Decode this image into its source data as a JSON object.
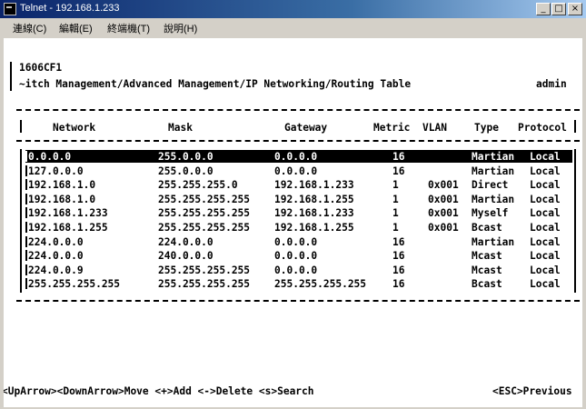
{
  "window": {
    "title": "Telnet - 192.168.1.233",
    "buttons": [
      "_",
      "□",
      "×"
    ]
  },
  "menu": {
    "items": [
      "連線(C)",
      "編輯(E)",
      "終端機(T)",
      "說明(H)"
    ]
  },
  "header": {
    "device": "1606CF1",
    "path": "~itch Management/Advanced Management/IP Networking/Routing Table",
    "user": "admin"
  },
  "table": {
    "columns": [
      "Network",
      "Mask",
      "Gateway",
      "Metric",
      "VLAN",
      "Type",
      "Protocol"
    ],
    "rows": [
      {
        "network": "0.0.0.0",
        "mask": "255.0.0.0",
        "gateway": "0.0.0.0",
        "metric": "16",
        "vlan": "",
        "type": "Martian",
        "protocol": "Local",
        "selected": true
      },
      {
        "network": "127.0.0.0",
        "mask": "255.0.0.0",
        "gateway": "0.0.0.0",
        "metric": "16",
        "vlan": "",
        "type": "Martian",
        "protocol": "Local"
      },
      {
        "network": "192.168.1.0",
        "mask": "255.255.255.0",
        "gateway": "192.168.1.233",
        "metric": "1",
        "vlan": "0x001",
        "type": "Direct",
        "protocol": "Local"
      },
      {
        "network": "192.168.1.0",
        "mask": "255.255.255.255",
        "gateway": "192.168.1.255",
        "metric": "1",
        "vlan": "0x001",
        "type": "Martian",
        "protocol": "Local"
      },
      {
        "network": "192.168.1.233",
        "mask": "255.255.255.255",
        "gateway": "192.168.1.233",
        "metric": "1",
        "vlan": "0x001",
        "type": "Myself",
        "protocol": "Local"
      },
      {
        "network": "192.168.1.255",
        "mask": "255.255.255.255",
        "gateway": "192.168.1.255",
        "metric": "1",
        "vlan": "0x001",
        "type": "Bcast",
        "protocol": "Local"
      },
      {
        "network": "224.0.0.0",
        "mask": "224.0.0.0",
        "gateway": "0.0.0.0",
        "metric": "16",
        "vlan": "",
        "type": "Martian",
        "protocol": "Local"
      },
      {
        "network": "224.0.0.0",
        "mask": "240.0.0.0",
        "gateway": "0.0.0.0",
        "metric": "16",
        "vlan": "",
        "type": "Mcast",
        "protocol": "Local"
      },
      {
        "network": "224.0.0.9",
        "mask": "255.255.255.255",
        "gateway": "0.0.0.0",
        "metric": "16",
        "vlan": "",
        "type": "Mcast",
        "protocol": "Local"
      },
      {
        "network": "255.255.255.255",
        "mask": "255.255.255.255",
        "gateway": "255.255.255.255",
        "metric": "16",
        "vlan": "",
        "type": "Bcast",
        "protocol": "Local"
      }
    ]
  },
  "footer": {
    "left": "<UpArrow><DownArrow>Move <+>Add <->Delete <s>Search",
    "right": "<ESC>Previous"
  }
}
